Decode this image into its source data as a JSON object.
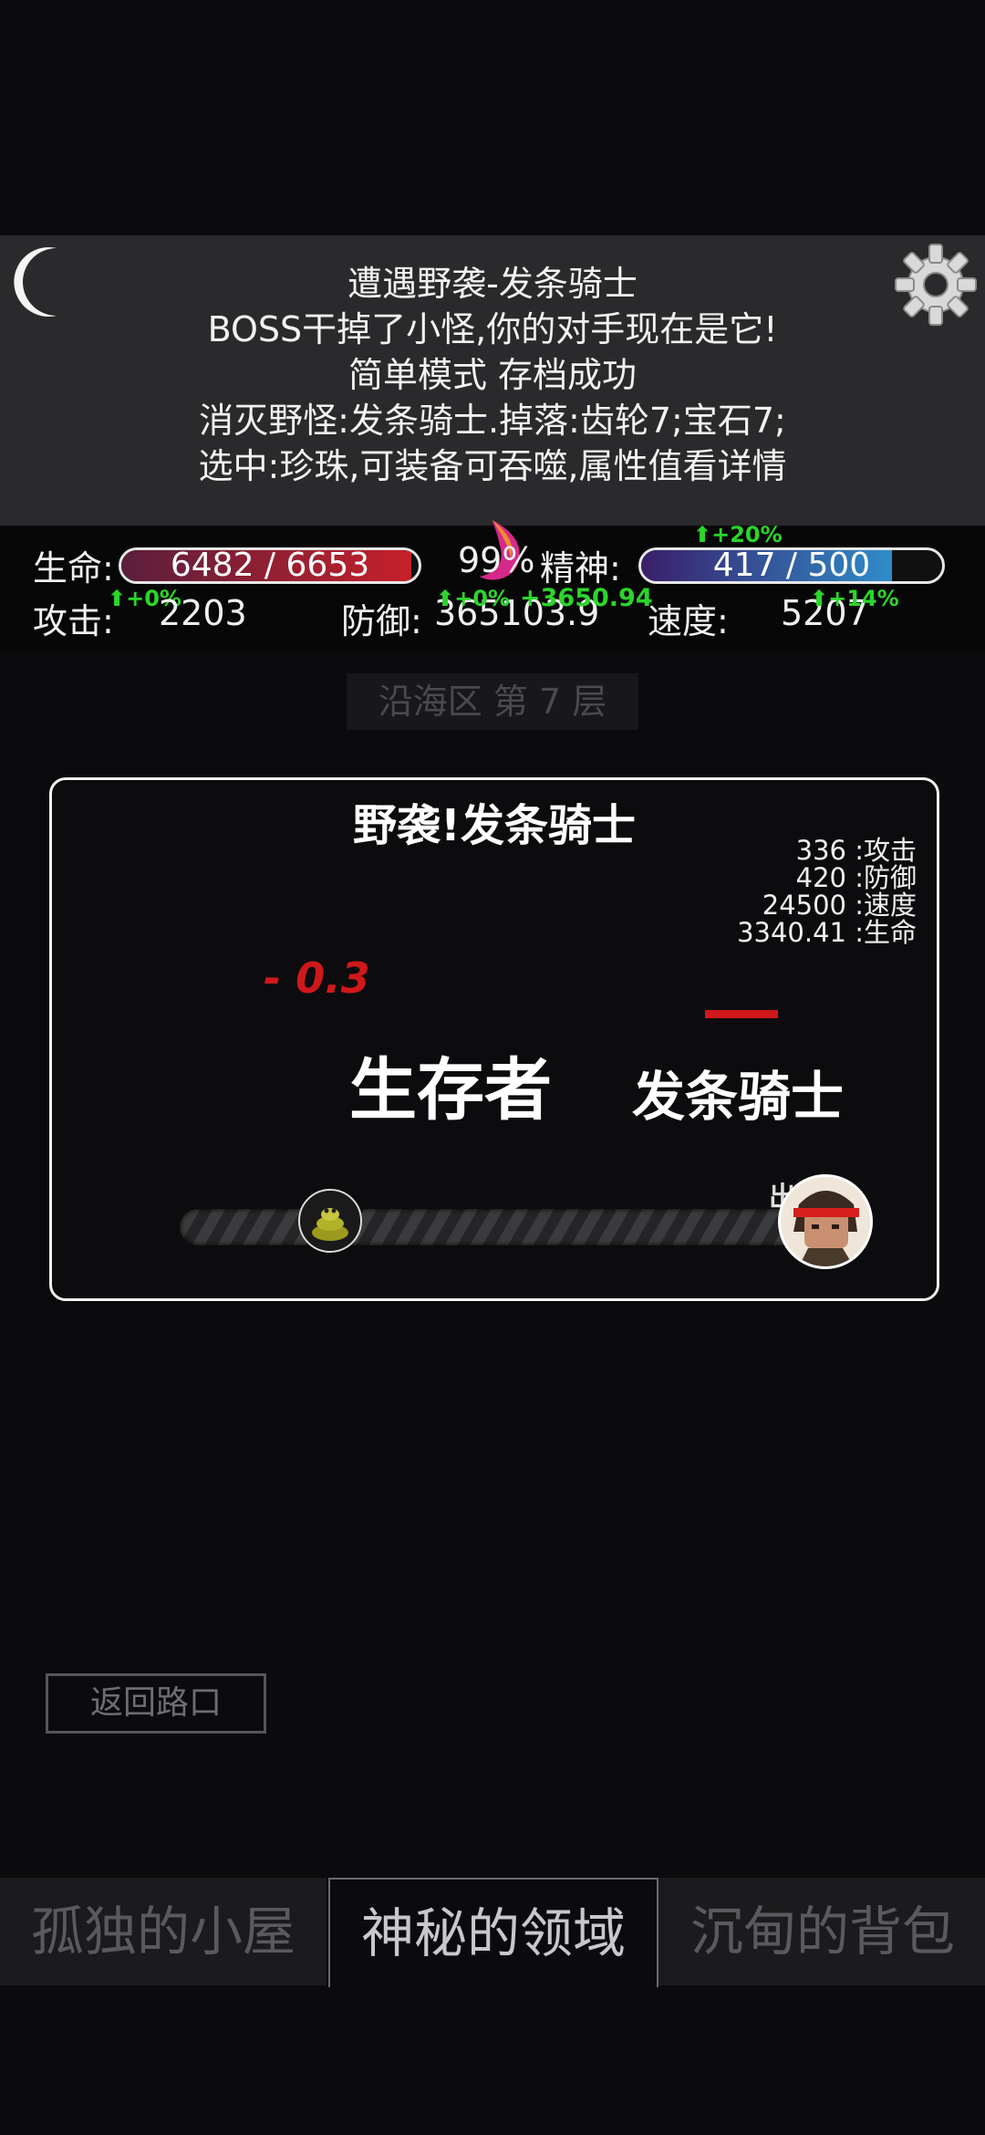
{
  "log": {
    "lines": [
      "遭遇野袭-发条骑士",
      "BOSS干掉了小怪,你的对手现在是它!",
      "简单模式 存档成功",
      "消灭野怪:发条骑士.掉落:齿轮7;宝石7;",
      "选中:珍珠,可装备可吞噬,属性值看详情"
    ]
  },
  "stats": {
    "hp_label": "生命:",
    "hp_value": "6482 / 6653",
    "hp_fraction": 0.974,
    "center_percent": "99%",
    "spirit_label": "精神:",
    "spirit_value": "417 / 500",
    "spirit_fraction": 0.834,
    "spirit_bonus": "+20%",
    "attack_label": "攻击:",
    "attack_value": "2203",
    "attack_bonus": "+0%",
    "defense_label": "防御:",
    "defense_value": "365103.9",
    "defense_bonus": "+0%",
    "defense_gain": "+3650.94",
    "speed_label": "速度:",
    "speed_value": "5207",
    "speed_bonus": "+14%"
  },
  "area": {
    "label": "沿海区 第 7 层"
  },
  "battle": {
    "title": "野袭!发条骑士",
    "enemy_stats": [
      "336 :攻击",
      "420 :防御",
      "24500 :速度",
      "3340.41 :生命"
    ],
    "damage": "- 0.3",
    "player_name": "生存者",
    "enemy_name": "发条骑士",
    "hero_tag": "出"
  },
  "buttons": {
    "return": "返回路口"
  },
  "tabs": [
    {
      "label": "孤独的小屋",
      "active": false
    },
    {
      "label": "神秘的领域",
      "active": true
    },
    {
      "label": "沉甸的背包",
      "active": false
    }
  ],
  "colors": {
    "hp_fill": "#c5202a",
    "spirit_fill": "#2f8cc9",
    "bonus_green": "#2bd52b",
    "damage_red": "#d0181a"
  }
}
